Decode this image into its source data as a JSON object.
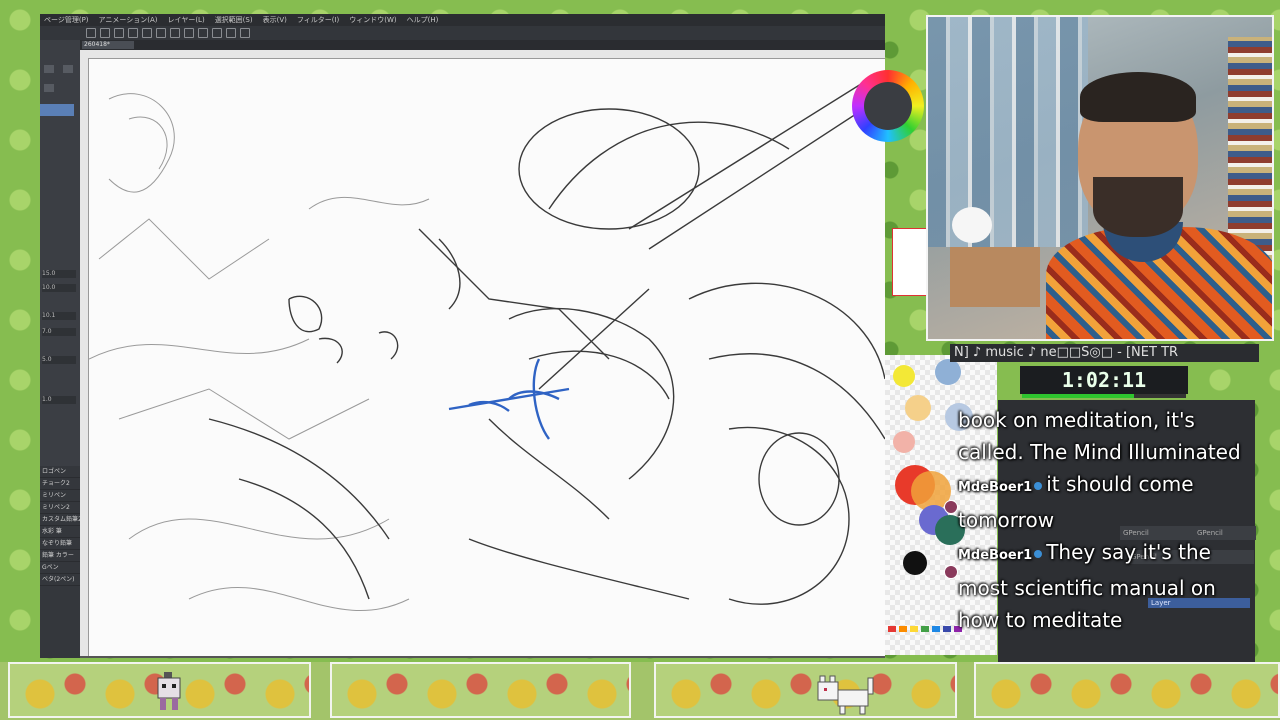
{
  "app": {
    "menu": [
      "ページ管理(P)",
      "アニメーション(A)",
      "レイヤー(L)",
      "選択範囲(S)",
      "表示(V)",
      "フィルター(I)",
      "ウィンドウ(W)",
      "ヘルプ(H)"
    ],
    "tab_label": "260418*"
  },
  "tool_panel": {
    "brush_sizes": [
      "15.0",
      "10.0",
      "10.1",
      "7.0",
      "5.0",
      "1.0"
    ],
    "sub_tools": [
      "ロゴペン",
      "チョーク2",
      "ミリペン",
      "ミリペン2",
      "カスタム鉛筆2",
      "水彩 筆",
      "なぞり鉛筆",
      "鉛筆 カラー",
      "Gペン",
      "ベタ(2ペン)"
    ]
  },
  "stream": {
    "music_text": "N]  ♪ music ♪  ne□□S◎□ - [NET TR",
    "timer": "1:02:11",
    "timer_progress": 0.68
  },
  "chat": {
    "messages": [
      {
        "user": "",
        "text": "book on meditation, it's called. The Mind Illuminated"
      },
      {
        "user": "MdeBoer1",
        "text": "it should come tomorrow"
      },
      {
        "user": "MdeBoer1",
        "text": "They say it's the most scientific manual on how to meditate"
      }
    ],
    "badge_color": "#3b8fd6"
  },
  "layer_panel": {
    "layer_a": "GPencil",
    "layer_b": "GPencil",
    "layer_c": "GPencil",
    "layer_d": "Layer"
  },
  "colors": {
    "accent": "#5a7fb6",
    "timer_bar": "#2ec52e"
  }
}
